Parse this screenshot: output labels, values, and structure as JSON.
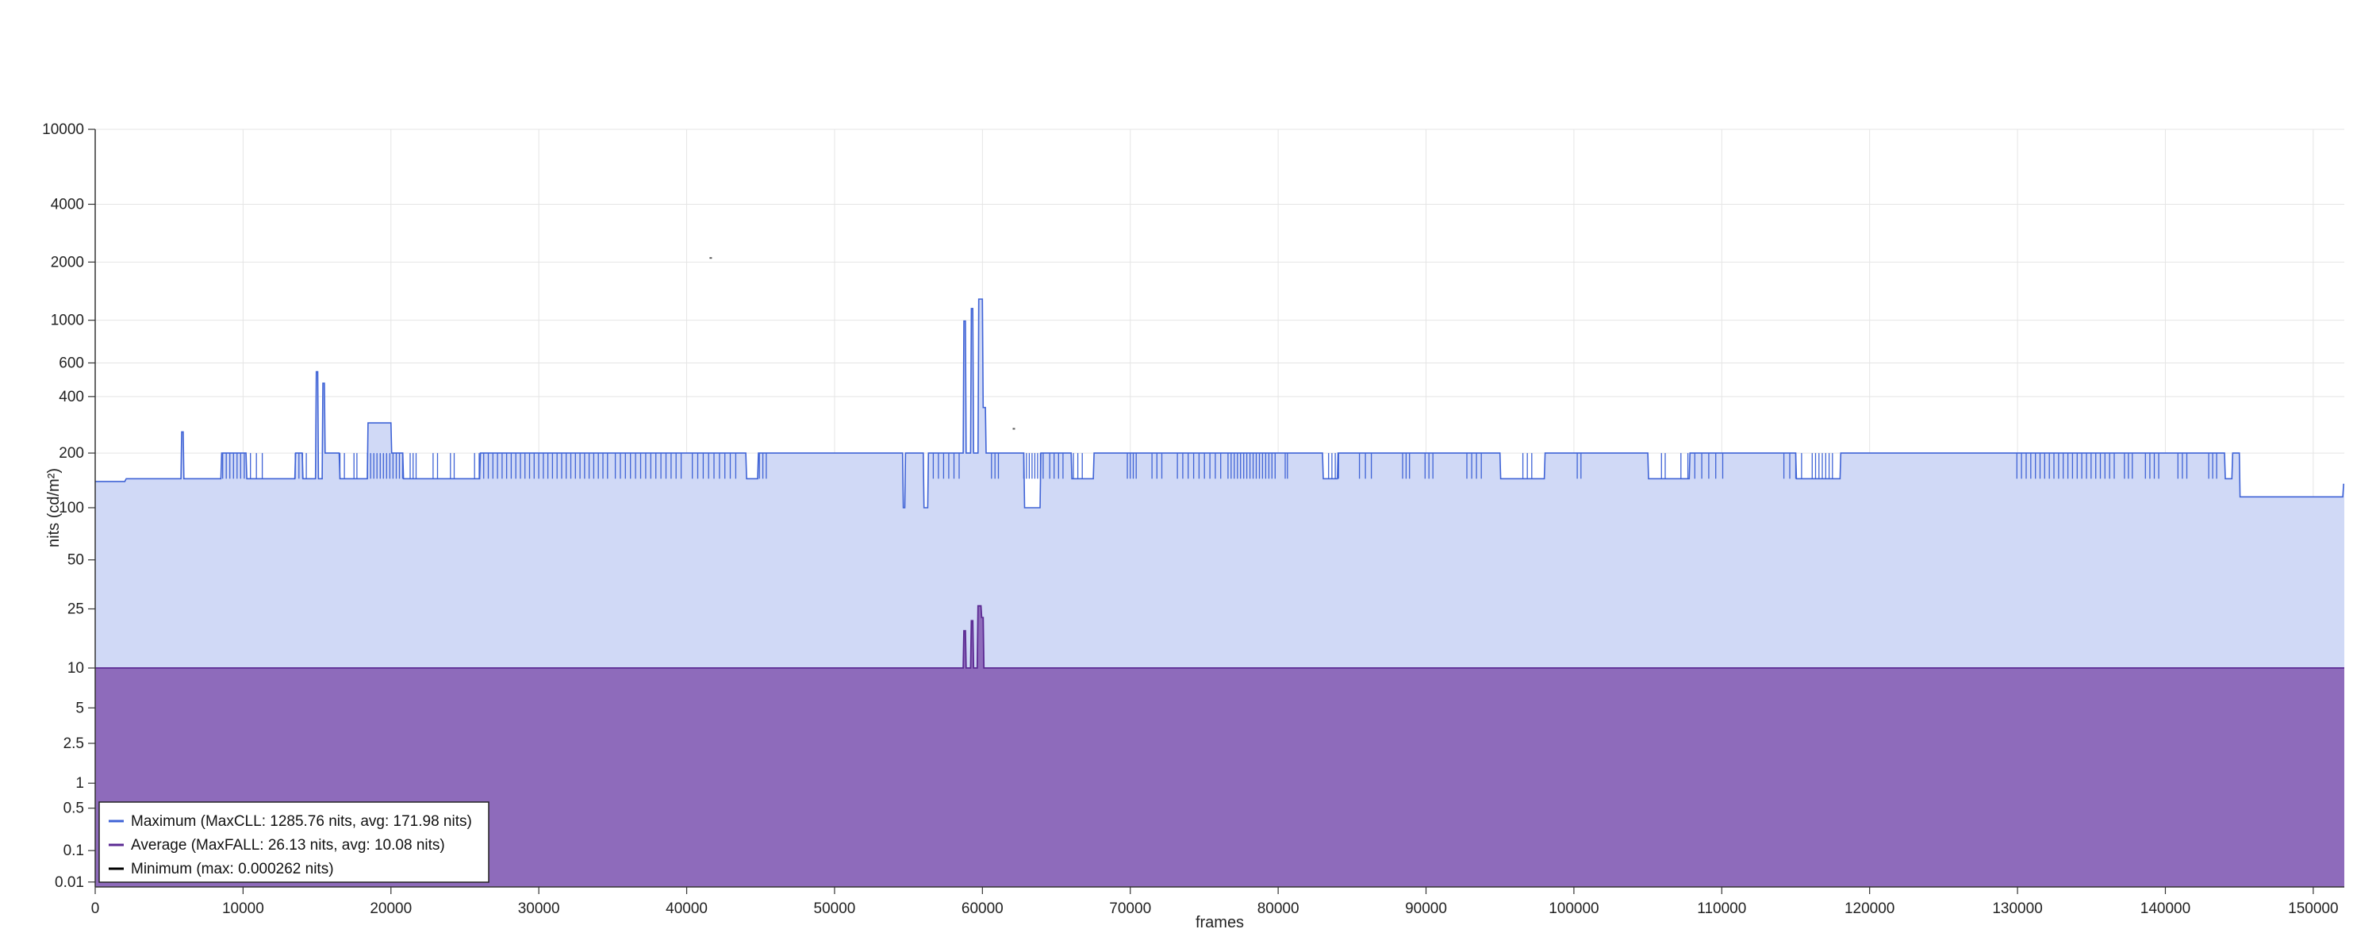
{
  "chart_data": {
    "type": "area",
    "title": "",
    "xlabel": "frames",
    "ylabel": "nits (cd/m²)",
    "xlim": [
      0,
      152100
    ],
    "ylim": [
      0.005,
      10000
    ],
    "y_scale": "pq",
    "grid": true,
    "legend_position": "bottom-left",
    "x_ticks": [
      0,
      10000,
      20000,
      30000,
      40000,
      50000,
      60000,
      70000,
      80000,
      90000,
      100000,
      110000,
      120000,
      130000,
      140000,
      150000
    ],
    "x_tick_labels": [
      "0",
      "10000",
      "20000",
      "30000",
      "40000",
      "50000",
      "60000",
      "70000",
      "80000",
      "90000",
      "100000",
      "110000",
      "120000",
      "130000",
      "140000",
      "150000"
    ],
    "y_ticks": [
      0.01,
      0.1,
      0.5,
      1,
      2.5,
      5,
      10,
      25,
      50,
      100,
      200,
      400,
      600,
      1000,
      2000,
      4000,
      10000
    ],
    "y_tick_labels": [
      "0.01",
      "0.1",
      "0.5",
      "1",
      "2.5",
      "5",
      "10",
      "25",
      "50",
      "100",
      "200",
      "400",
      "600",
      "1000",
      "2000",
      "4000",
      "10000"
    ],
    "series": [
      {
        "name": "Maximum (MaxCLL: 1285.76 nits, avg: 171.98 nits)",
        "color": "#3f63d6",
        "fill": "#d0d9f6",
        "points": [
          [
            0,
            140
          ],
          [
            2000,
            140
          ],
          [
            2100,
            145
          ],
          [
            5800,
            145
          ],
          [
            5850,
            260
          ],
          [
            5950,
            260
          ],
          [
            6000,
            145
          ],
          [
            8500,
            145
          ],
          [
            8550,
            200
          ],
          [
            10200,
            200
          ],
          [
            10250,
            145
          ],
          [
            13500,
            145
          ],
          [
            13550,
            200
          ],
          [
            14000,
            200
          ],
          [
            14050,
            145
          ],
          [
            14900,
            145
          ],
          [
            14950,
            540
          ],
          [
            15050,
            540
          ],
          [
            15100,
            145
          ],
          [
            15350,
            145
          ],
          [
            15400,
            470
          ],
          [
            15500,
            470
          ],
          [
            15550,
            200
          ],
          [
            16500,
            200
          ],
          [
            16550,
            145
          ],
          [
            18400,
            145
          ],
          [
            18450,
            290
          ],
          [
            20000,
            290
          ],
          [
            20050,
            200
          ],
          [
            20800,
            200
          ],
          [
            20850,
            145
          ],
          [
            26000,
            145
          ],
          [
            26050,
            200
          ],
          [
            44000,
            200
          ],
          [
            44050,
            145
          ],
          [
            44800,
            145
          ],
          [
            44850,
            200
          ],
          [
            54600,
            200
          ],
          [
            54650,
            100
          ],
          [
            54750,
            100
          ],
          [
            54800,
            200
          ],
          [
            56000,
            200
          ],
          [
            56050,
            100
          ],
          [
            56300,
            100
          ],
          [
            56350,
            200
          ],
          [
            58700,
            200
          ],
          [
            58750,
            990
          ],
          [
            58850,
            990
          ],
          [
            58900,
            200
          ],
          [
            59200,
            200
          ],
          [
            59250,
            1150
          ],
          [
            59350,
            1150
          ],
          [
            59400,
            200
          ],
          [
            59700,
            200
          ],
          [
            59750,
            1285.76
          ],
          [
            60000,
            1285.76
          ],
          [
            60050,
            350
          ],
          [
            60200,
            350
          ],
          [
            60250,
            200
          ],
          [
            62800,
            200
          ],
          [
            62850,
            100
          ],
          [
            63900,
            100
          ],
          [
            63950,
            200
          ],
          [
            66000,
            200
          ],
          [
            66050,
            145
          ],
          [
            67500,
            145
          ],
          [
            67550,
            200
          ],
          [
            83000,
            200
          ],
          [
            83050,
            145
          ],
          [
            84000,
            145
          ],
          [
            84050,
            200
          ],
          [
            95000,
            200
          ],
          [
            95050,
            145
          ],
          [
            98000,
            145
          ],
          [
            98050,
            200
          ],
          [
            105000,
            200
          ],
          [
            105050,
            145
          ],
          [
            107800,
            145
          ],
          [
            107850,
            200
          ],
          [
            115000,
            200
          ],
          [
            115050,
            145
          ],
          [
            118000,
            145
          ],
          [
            118050,
            200
          ],
          [
            144000,
            200
          ],
          [
            144050,
            145
          ],
          [
            144500,
            145
          ],
          [
            144550,
            200
          ],
          [
            145000,
            200
          ],
          [
            145050,
            115
          ],
          [
            152000,
            115
          ],
          [
            152050,
            135
          ],
          [
            152100,
            135
          ]
        ],
        "toggle_bands": [
          [
            8500,
            10200,
            7
          ],
          [
            10300,
            11500,
            3
          ],
          [
            13400,
            14400,
            4
          ],
          [
            16400,
            17000,
            2
          ],
          [
            17400,
            17800,
            2
          ],
          [
            18300,
            20900,
            12
          ],
          [
            21200,
            21800,
            3
          ],
          [
            22700,
            23300,
            2
          ],
          [
            23900,
            24400,
            2
          ],
          [
            25500,
            34800,
            30
          ],
          [
            35000,
            39800,
            14
          ],
          [
            40200,
            43500,
            9
          ],
          [
            44800,
            45500,
            3
          ],
          [
            56500,
            58600,
            6
          ],
          [
            60500,
            61200,
            3
          ],
          [
            62700,
            64200,
            8
          ],
          [
            64400,
            65600,
            4
          ],
          [
            66000,
            66900,
            3
          ],
          [
            69700,
            70500,
            4
          ],
          [
            71300,
            72300,
            3
          ],
          [
            73000,
            76300,
            9
          ],
          [
            76500,
            79900,
            16
          ],
          [
            80400,
            80700,
            2
          ],
          [
            83300,
            84200,
            4
          ],
          [
            85300,
            86500,
            3
          ],
          [
            88300,
            89000,
            3
          ],
          [
            89800,
            90600,
            3
          ],
          [
            92600,
            93900,
            4
          ],
          [
            96400,
            97300,
            3
          ],
          [
            100100,
            100600,
            2
          ],
          [
            105800,
            106300,
            2
          ],
          [
            107000,
            110300,
            7
          ],
          [
            114000,
            115600,
            4
          ],
          [
            116000,
            117600,
            7
          ],
          [
            129800,
            136700,
            22
          ],
          [
            137100,
            137900,
            3
          ],
          [
            138500,
            139700,
            4
          ],
          [
            140700,
            141600,
            3
          ],
          [
            142800,
            143600,
            3
          ]
        ]
      },
      {
        "name": "Average (MaxFALL: 26.13 nits, avg: 10.08 nits)",
        "color": "#5b2a93",
        "fill": "#8e6bbb",
        "points": [
          [
            0,
            10
          ],
          [
            58700,
            10
          ],
          [
            58750,
            18
          ],
          [
            58850,
            18
          ],
          [
            58900,
            10
          ],
          [
            59200,
            10
          ],
          [
            59250,
            21
          ],
          [
            59350,
            21
          ],
          [
            59400,
            10
          ],
          [
            59650,
            10
          ],
          [
            59700,
            26.13
          ],
          [
            59900,
            26.13
          ],
          [
            59950,
            22
          ],
          [
            60050,
            22
          ],
          [
            60100,
            10
          ],
          [
            152100,
            10
          ]
        ]
      },
      {
        "name": "Minimum (max: 0.000262 nits)",
        "color": "#000000",
        "points": [
          [
            0,
            0.000262
          ],
          [
            152100,
            0.000262
          ]
        ]
      }
    ],
    "stray_points": [
      [
        41600,
        2100
      ],
      [
        62100,
        270
      ]
    ]
  }
}
